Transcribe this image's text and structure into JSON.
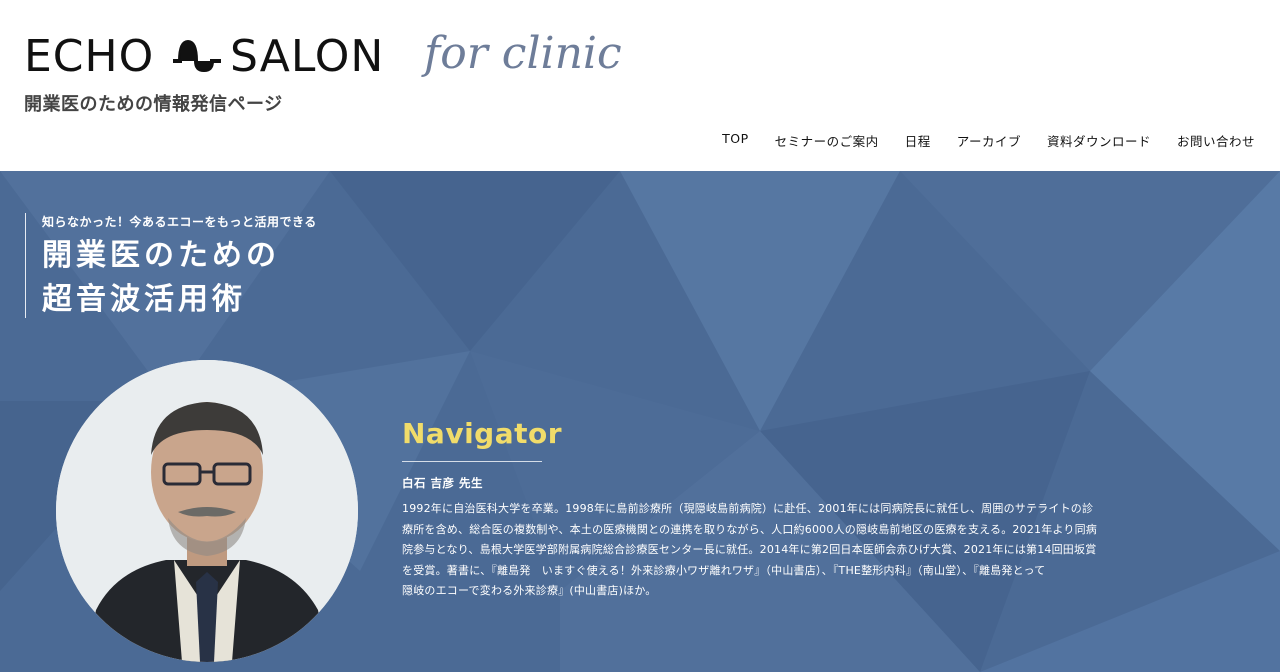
{
  "header": {
    "logo_left": "ECHO",
    "logo_right": "SALON",
    "logo_icon": "wave-icon",
    "logo_sub": "開業医のための情報発信ページ",
    "tagline": "for clinic"
  },
  "nav": {
    "items": [
      "TOP",
      "セミナーのご案内",
      "日程",
      "アーカイブ",
      "資料ダウンロード",
      "お問い合わせ"
    ]
  },
  "hero": {
    "kicker": "知らなかった！今あるエコーをもっと活用できる",
    "title_line1": "開業医のための",
    "title_line2": "超音波活用術",
    "background_color": "#4b6a95"
  },
  "navigator": {
    "label": "Navigator",
    "label_color": "#f1dc6a",
    "name": "白石 吉彦 先生",
    "bio_lines": [
      "1992年に自治医科大学を卒業。1998年に島前診療所（現隠岐島前病院）に赴任、2001年には同病院長に就任し、周囲のサテライトの診",
      "療所を含め、総合医の複数制や、本土の医療機関との連携を取りながら、人口約6000人の隠岐島前地区の医療を支える。2021年より同病",
      "院参与となり、島根大学医学部附属病院総合診療医センター長に就任。2014年に第2回日本医師会赤ひげ大賞、2021年には第14回田坂賞",
      "を受賞。著書に、『離島発　いますぐ使える！外来診療小ワザ離れワザ』（中山書店）、『THE整形内科』（南山堂）、『離島発とって",
      "隠岐のエコーで変わる外来診療』(中山書店)ほか。"
    ]
  }
}
